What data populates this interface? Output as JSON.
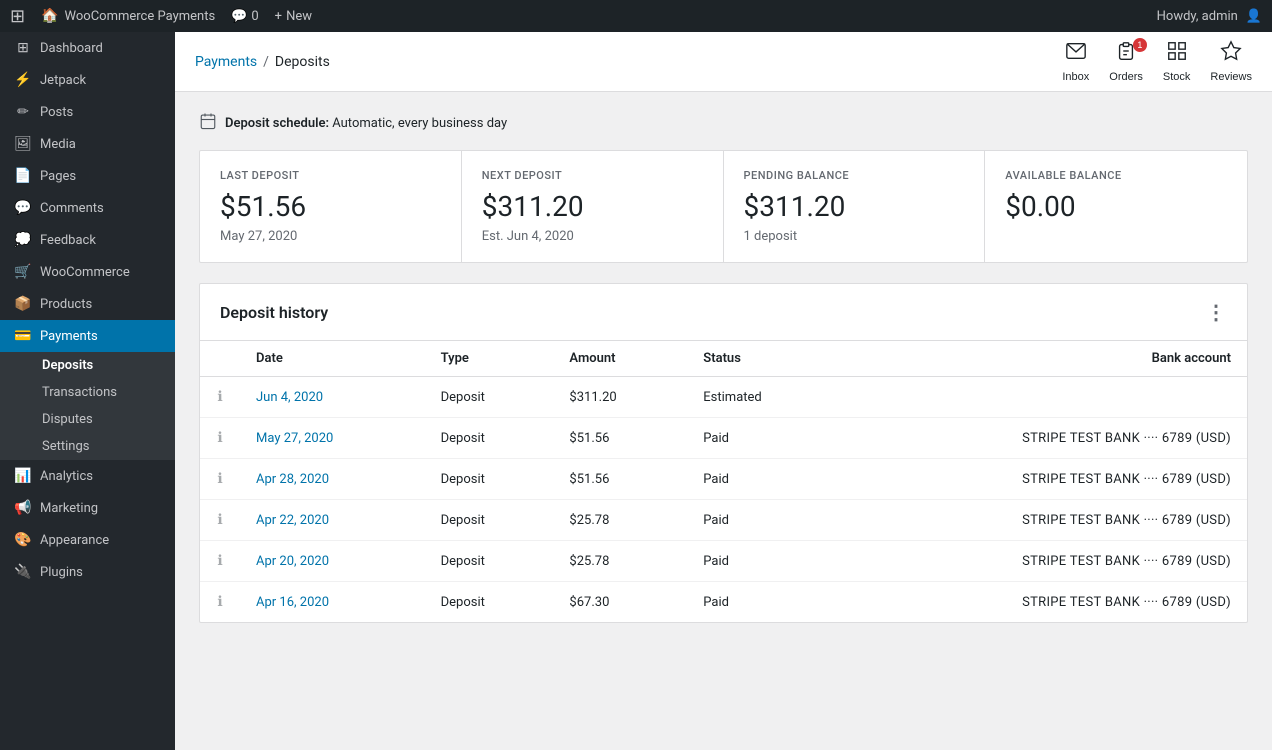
{
  "adminBar": {
    "logo": "W",
    "siteName": "WooCommerce Payments",
    "comments": "0",
    "new": "New",
    "user": "Howdy, admin"
  },
  "sidebar": {
    "items": [
      {
        "id": "dashboard",
        "label": "Dashboard",
        "icon": "⊞"
      },
      {
        "id": "jetpack",
        "label": "Jetpack",
        "icon": "⚡"
      },
      {
        "id": "posts",
        "label": "Posts",
        "icon": "📄"
      },
      {
        "id": "media",
        "label": "Media",
        "icon": "🖼"
      },
      {
        "id": "pages",
        "label": "Pages",
        "icon": "📋"
      },
      {
        "id": "comments",
        "label": "Comments",
        "icon": "💬"
      },
      {
        "id": "feedback",
        "label": "Feedback",
        "icon": "💭"
      },
      {
        "id": "woocommerce",
        "label": "WooCommerce",
        "icon": "🛒"
      },
      {
        "id": "products",
        "label": "Products",
        "icon": "📦"
      },
      {
        "id": "payments",
        "label": "Payments",
        "icon": "💳",
        "active": true
      },
      {
        "id": "analytics",
        "label": "Analytics",
        "icon": "📊"
      },
      {
        "id": "marketing",
        "label": "Marketing",
        "icon": "📢"
      },
      {
        "id": "appearance",
        "label": "Appearance",
        "icon": "🎨"
      },
      {
        "id": "plugins",
        "label": "Plugins",
        "icon": "🔌"
      }
    ],
    "submenu": {
      "paymentsActive": true,
      "items": [
        {
          "id": "deposits",
          "label": "Deposits",
          "active": true
        },
        {
          "id": "transactions",
          "label": "Transactions"
        },
        {
          "id": "disputes",
          "label": "Disputes"
        },
        {
          "id": "settings",
          "label": "Settings"
        }
      ]
    }
  },
  "header": {
    "breadcrumb": {
      "parent": "Payments",
      "separator": "/",
      "current": "Deposits"
    },
    "actions": [
      {
        "id": "inbox",
        "label": "Inbox",
        "icon": "📥",
        "badge": ""
      },
      {
        "id": "orders",
        "label": "Orders",
        "icon": "📋",
        "badge": "1"
      },
      {
        "id": "stock",
        "label": "Stock",
        "icon": "⊞",
        "badge": ""
      },
      {
        "id": "reviews",
        "label": "Reviews",
        "icon": "★",
        "badge": ""
      }
    ]
  },
  "depositSchedule": {
    "label": "Deposit schedule:",
    "value": "Automatic, every business day"
  },
  "statsCards": [
    {
      "id": "last-deposit",
      "label": "LAST DEPOSIT",
      "value": "$51.56",
      "sub": "May 27, 2020"
    },
    {
      "id": "next-deposit",
      "label": "NEXT DEPOSIT",
      "value": "$311.20",
      "sub": "Est. Jun 4, 2020"
    },
    {
      "id": "pending-balance",
      "label": "PENDING BALANCE",
      "value": "$311.20",
      "sub": "1 deposit"
    },
    {
      "id": "available-balance",
      "label": "AVAILABLE BALANCE",
      "value": "$0.00",
      "sub": ""
    }
  ],
  "depositHistory": {
    "title": "Deposit history",
    "columns": [
      "Date",
      "Type",
      "Amount",
      "Status",
      "Bank account"
    ],
    "rows": [
      {
        "date": "Jun 4, 2020",
        "type": "Deposit",
        "amount": "$311.20",
        "status": "Estimated",
        "bank": ""
      },
      {
        "date": "May 27, 2020",
        "type": "Deposit",
        "amount": "$51.56",
        "status": "Paid",
        "bank": "STRIPE TEST BANK ···· 6789 (USD)"
      },
      {
        "date": "Apr 28, 2020",
        "type": "Deposit",
        "amount": "$51.56",
        "status": "Paid",
        "bank": "STRIPE TEST BANK ···· 6789 (USD)"
      },
      {
        "date": "Apr 22, 2020",
        "type": "Deposit",
        "amount": "$25.78",
        "status": "Paid",
        "bank": "STRIPE TEST BANK ···· 6789 (USD)"
      },
      {
        "date": "Apr 20, 2020",
        "type": "Deposit",
        "amount": "$25.78",
        "status": "Paid",
        "bank": "STRIPE TEST BANK ···· 6789 (USD)"
      },
      {
        "date": "Apr 16, 2020",
        "type": "Deposit",
        "amount": "$67.30",
        "status": "Paid",
        "bank": "STRIPE TEST BANK ···· 6789 (USD)"
      }
    ]
  }
}
